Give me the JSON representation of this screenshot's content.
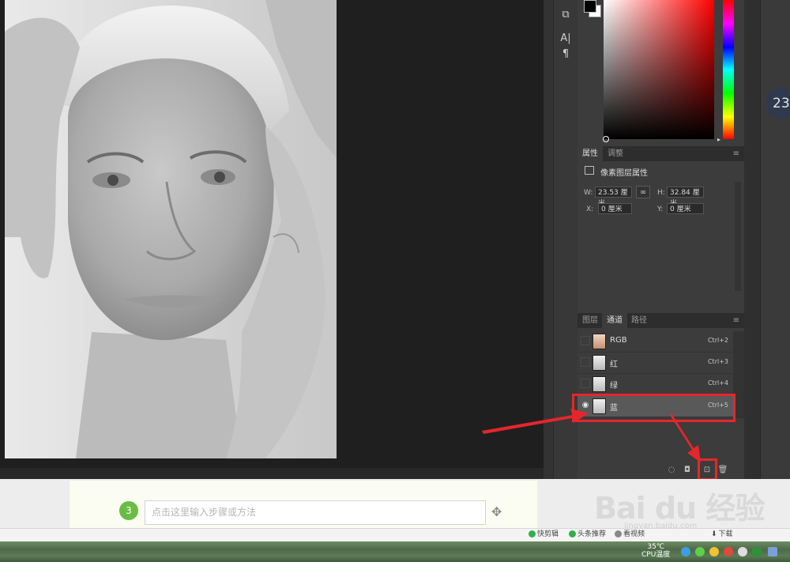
{
  "colors": {
    "accent_red": "#e6262b",
    "step_green": "#69bc45",
    "canvas_bg": "#1f1f1f",
    "panel_bg": "#3c3c3c"
  },
  "toolstrip": {
    "icons": [
      "transform-icon",
      "character-icon",
      "paragraph-icon"
    ],
    "char_label": "A|",
    "para_label": "¶"
  },
  "properties_panel": {
    "tabs": [
      "属性",
      "调整"
    ],
    "active_tab": "属性",
    "header": "像素图层属性",
    "w_label": "W:",
    "w_value": "23.53 厘米",
    "h_label": "H:",
    "h_value": "32.84 厘米",
    "x_label": "X:",
    "x_value": "0 厘米",
    "y_label": "Y:",
    "y_value": "0 厘米"
  },
  "channels_panel": {
    "tabs": [
      "图层",
      "通道",
      "路径"
    ],
    "active_tab": "通道",
    "rows": [
      {
        "name": "RGB",
        "shortcut": "Ctrl+2"
      },
      {
        "name": "红",
        "shortcut": "Ctrl+3"
      },
      {
        "name": "绿",
        "shortcut": "Ctrl+4"
      },
      {
        "name": "蓝",
        "shortcut": "Ctrl+5",
        "selected": true
      }
    ]
  },
  "step_editor": {
    "step_number": "3",
    "placeholder": "点击这里输入步骤或方法"
  },
  "watermark": {
    "brand": "Bai du 经验",
    "sub": "jingyan.baidu.com"
  },
  "statusbar": {
    "items": [
      "快剪辑",
      "头条推荐",
      "看视频",
      "下载"
    ]
  },
  "taskbar": {
    "temperature": "35℃",
    "cpu_label": "CPU温度"
  },
  "side_badge": "23"
}
